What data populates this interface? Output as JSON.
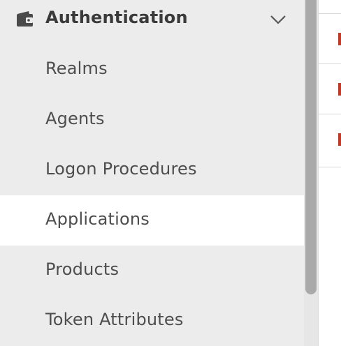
{
  "sidebar": {
    "section": {
      "title": "Authentication",
      "icon": "wallet-icon",
      "toggle_icon": "chevron-down-icon",
      "expanded": true
    },
    "items": [
      {
        "label": "Realms",
        "selected": false
      },
      {
        "label": "Agents",
        "selected": false
      },
      {
        "label": "Logon Procedures",
        "selected": false
      },
      {
        "label": "Applications",
        "selected": true
      },
      {
        "label": "Products",
        "selected": false
      },
      {
        "label": "Token Attributes",
        "selected": false
      }
    ]
  },
  "content": {
    "rows": [
      {
        "marker_color": "#c0392b"
      },
      {
        "marker_color": "#c0392b"
      },
      {
        "marker_color": "#c0392b"
      }
    ]
  },
  "colors": {
    "sidebar_bg": "#ececec",
    "selected_bg": "#ffffff",
    "text": "#4d4d4d",
    "accent": "#c0392b",
    "scrollbar_thumb": "#a9a9a9"
  }
}
